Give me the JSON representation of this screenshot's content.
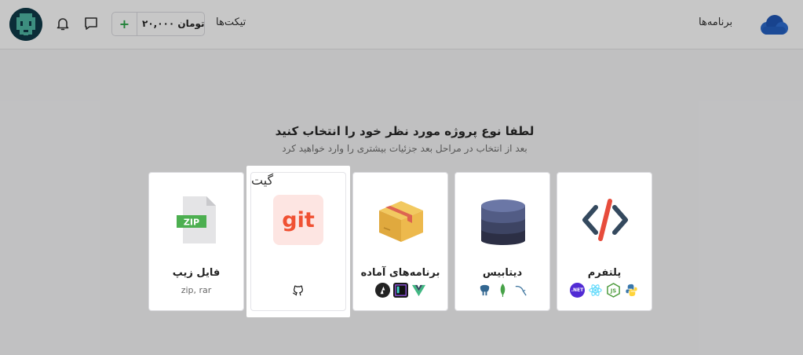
{
  "header": {
    "nav_programs": "برنامه‌ها",
    "nav_tickets": "تیکت‌ها",
    "wallet": {
      "plus": "+",
      "amount": "۲۰,۰۰۰ تومان"
    }
  },
  "main": {
    "title": "لطفا نوع پروژه مورد نظر خود را انتخاب کنید",
    "subtitle": "بعد از انتخاب در مراحل بعد جزئیات بیشتری را وارد خواهید کرد",
    "cards": [
      {
        "label": "پلتفرم",
        "techs": [
          "dotnet-icon",
          "react-icon",
          "nodejs-icon",
          "python-icon"
        ]
      },
      {
        "label": "دیتابیس",
        "techs": [
          "postgresql-icon",
          "mongodb-icon",
          "mysql-icon"
        ]
      },
      {
        "label": "برنامه‌های آماده",
        "techs": [
          "nuxt-icon",
          "phpstorm-icon",
          "vue-icon"
        ]
      },
      {
        "label": "گیت",
        "badge": "git"
      },
      {
        "label": "فایل زیپ",
        "sub": "zip, rar",
        "file_text": "ZIP"
      }
    ]
  },
  "colors": {
    "accent_green": "#2aa648",
    "git_red": "#f05133",
    "overlay": "rgba(0,0,0,0.22)"
  }
}
